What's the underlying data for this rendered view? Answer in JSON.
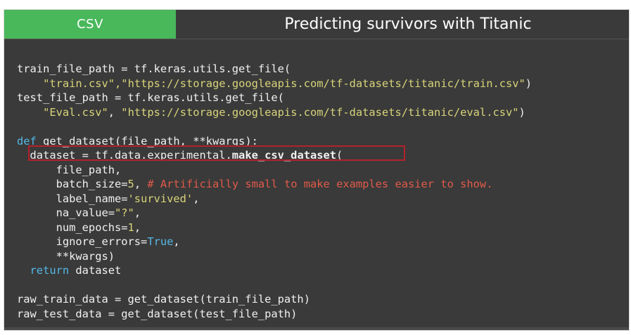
{
  "header": {
    "tab_label": "CSV",
    "title": "Predicting survivors with Titanic"
  },
  "code": {
    "l1_a": "train_file_path = tf.keras.utils.get_file(",
    "l2_indent": "    ",
    "l2_s1": "\"train.csv\"",
    "l2_comma": ",",
    "l2_s2": "\"https://storage.googleapis.com/tf-datasets/titanic/train.csv\"",
    "l2_end": ")",
    "l3_a": "test_file_path = tf.keras.utils.get_file(",
    "l4_indent": "    ",
    "l4_s1": "\"Eval.csv\"",
    "l4_comma": ", ",
    "l4_s2": "\"https://storage.googleapis.com/tf-datasets/titanic/eval.csv\"",
    "l4_end": ")",
    "l6_kw": "def",
    "l6_rest": " get_dataset(file_path, **kwargs):",
    "l7_a": "  dataset = tf.data.experimental.",
    "l7_bold": "make_csv_dataset",
    "l7_end": "(",
    "l8": "      file_path,",
    "l9_a": "      batch_size=",
    "l9_num": "5",
    "l9_comma": ", ",
    "l9_cmt": "# Artificially small to make examples easier to show.",
    "l10_a": "      label_name=",
    "l10_str": "'survived'",
    "l10_end": ",",
    "l11_a": "      na_value=",
    "l11_str": "\"?\"",
    "l11_end": ",",
    "l12_a": "      num_epochs=",
    "l12_num": "1",
    "l12_end": ",",
    "l13_a": "      ignore_errors=",
    "l13_kw": "True",
    "l13_end": ",",
    "l14": "      **kwargs)",
    "l15_kw": "  return",
    "l15_rest": " dataset",
    "l17": "raw_train_data = get_dataset(train_file_path)",
    "l18": "raw_test_data = get_dataset(test_file_path)"
  },
  "colors": {
    "tab_green": "#49b85b",
    "background": "#3a3a3a",
    "string": "#d8d47a",
    "keyword": "#55b8e6",
    "comment": "#e05a4a",
    "highlight_border": "#b3222c"
  }
}
